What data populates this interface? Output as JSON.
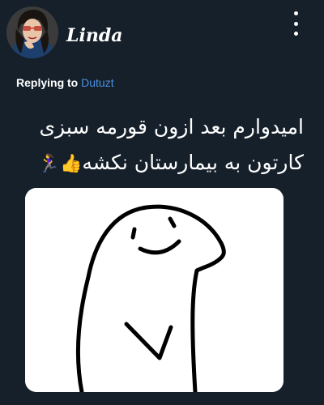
{
  "tweet": {
    "author": {
      "name": "Linda"
    },
    "reply": {
      "prefix": "Replying to",
      "handle": "Dutuzt"
    },
    "text_lines": [
      "امیدوارم بعد ازون قورمه سبزی",
      "کارتون به بیمارستان نکشه"
    ],
    "emojis": [
      "👍",
      "🏃‍♀️"
    ]
  },
  "icons": {
    "more": "more-vertical-icon"
  },
  "colors": {
    "background": "#15202b",
    "text": "#ffffff",
    "link": "#4a90e2",
    "media_background": "#ffffff"
  }
}
